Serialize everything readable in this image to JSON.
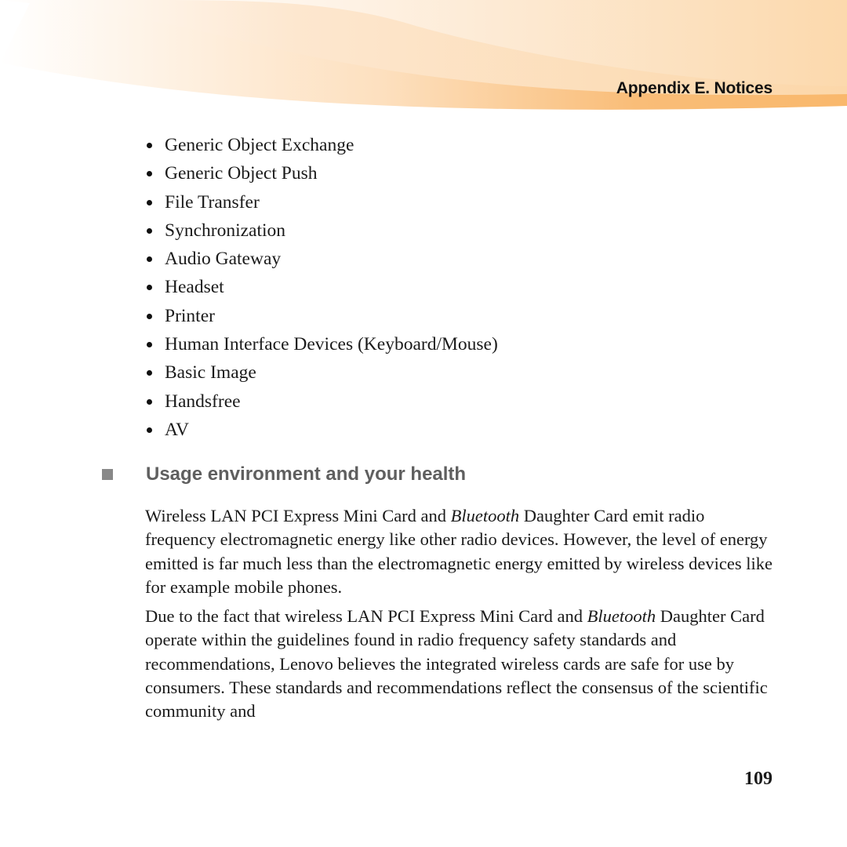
{
  "header": {
    "title": "Appendix E. Notices",
    "banner_colors": [
      "#fde3c4",
      "#fcd6a6",
      "#f9b86f"
    ]
  },
  "profiles_list": [
    "Generic Object Exchange",
    "Generic Object Push",
    "File Transfer",
    "Synchronization",
    "Audio Gateway",
    "Headset",
    "Printer",
    "Human Interface Devices (Keyboard/Mouse)",
    "Basic Image",
    "Handsfree",
    "AV"
  ],
  "section": {
    "heading": "Usage environment and your health",
    "paragraphs": [
      {
        "before_italic": "Wireless LAN PCI Express Mini Card and ",
        "italic": "Bluetooth",
        "after_italic": " Daughter Card emit radio frequency electromagnetic energy like other radio devices. However, the level of energy emitted is far much less than the electromagnetic energy emitted by wireless devices like for example mobile phones."
      },
      {
        "before_italic": "Due to the fact that wireless LAN PCI Express Mini Card and ",
        "italic": "Bluetooth",
        "after_italic": " Daughter Card operate within the guidelines found in radio frequency safety standards and recommendations, Lenovo believes the integrated wireless cards are safe for use by consumers. These standards and recommendations reflect the consensus of the scientific community and"
      }
    ]
  },
  "footer": {
    "page_number": "109"
  }
}
